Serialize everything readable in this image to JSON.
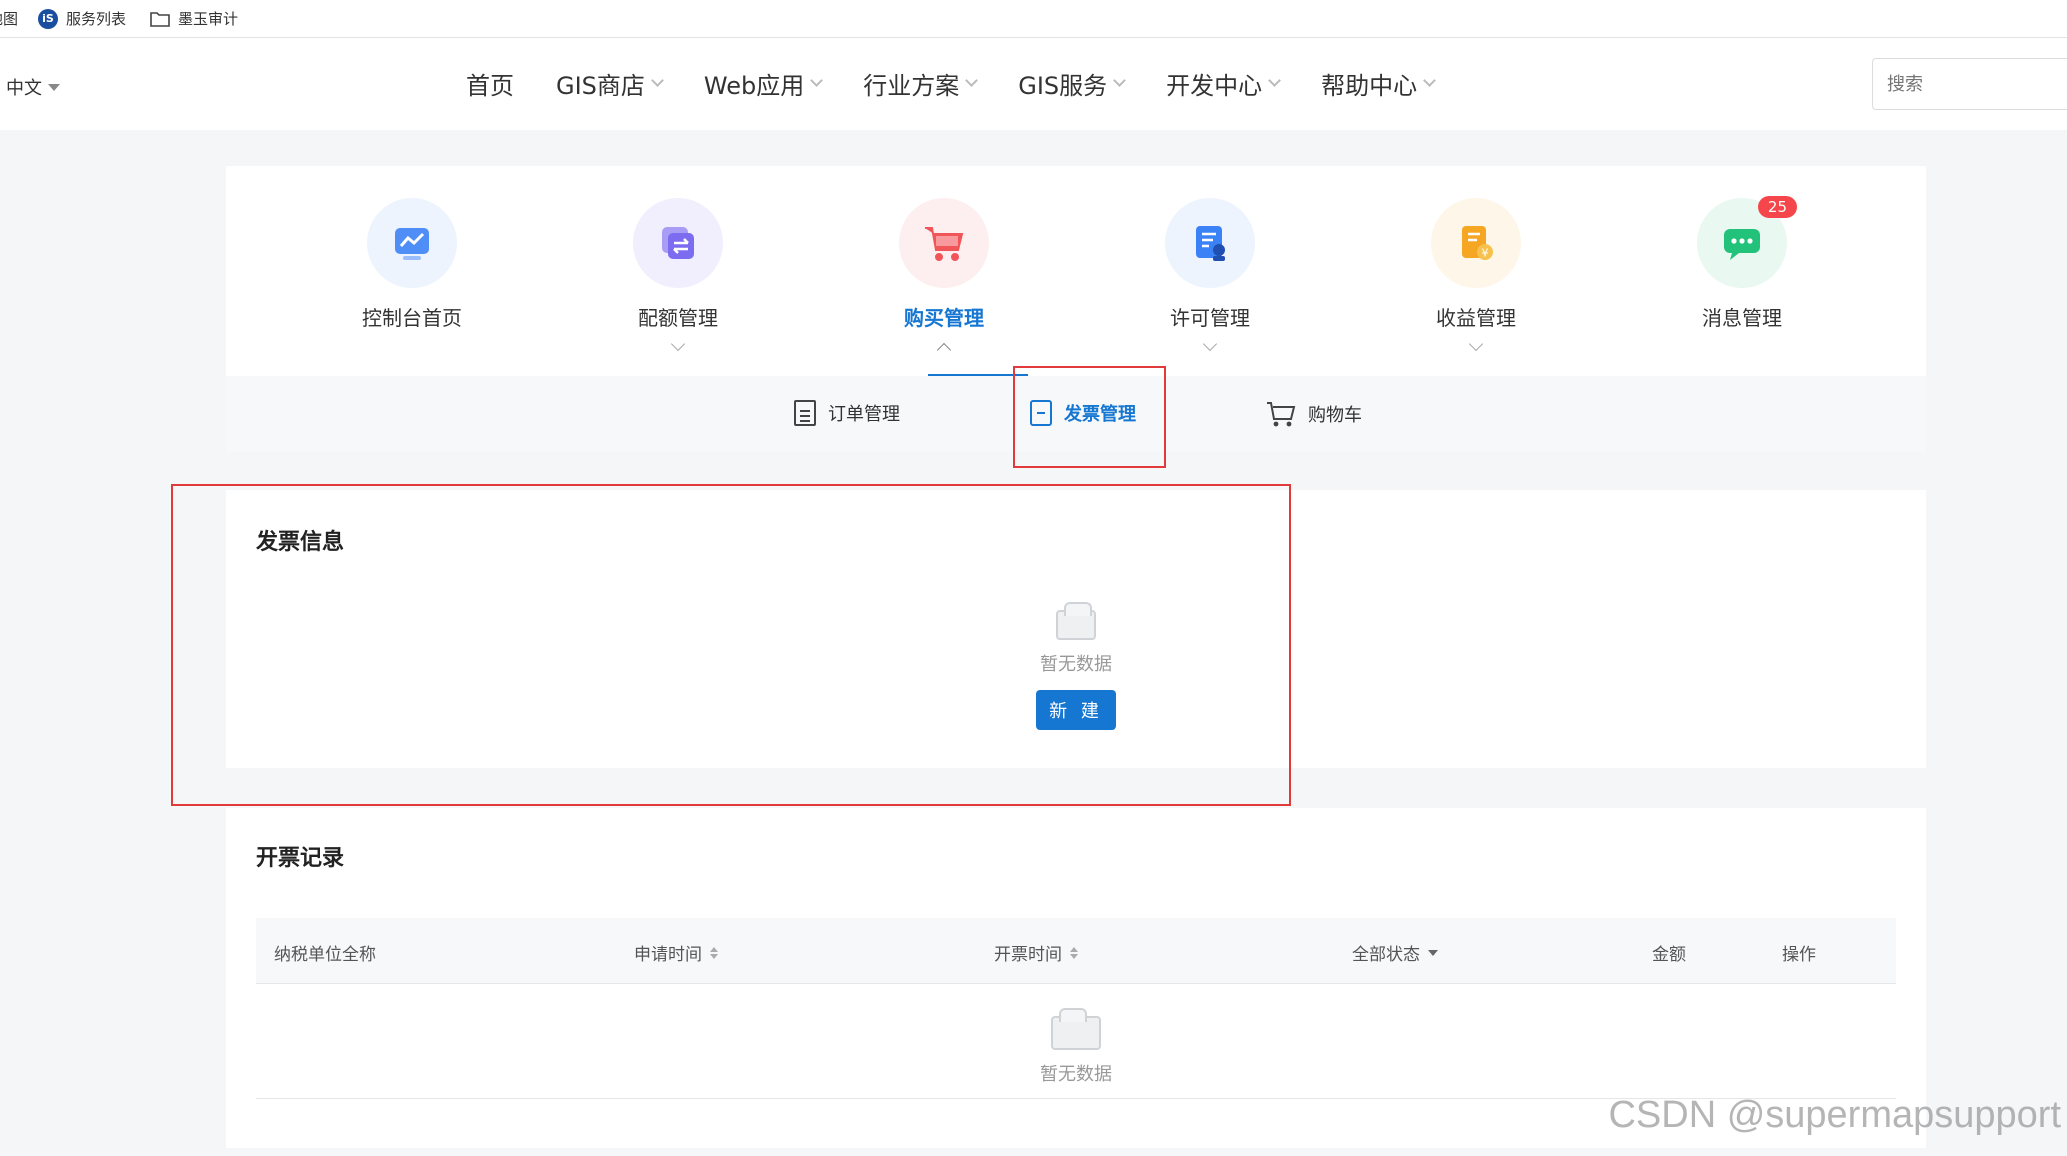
{
  "bookmarks": {
    "items": [
      {
        "label": "地图",
        "icon": "map-icon"
      },
      {
        "label": "服务列表",
        "icon": "iserver-logo-icon"
      },
      {
        "label": "墨玉审计",
        "icon": "folder-icon"
      }
    ],
    "logo_text": "iS"
  },
  "nav": {
    "language": "中文",
    "menu": [
      {
        "label": "首页",
        "has_dropdown": false
      },
      {
        "label": "GIS商店",
        "has_dropdown": true
      },
      {
        "label": "Web应用",
        "has_dropdown": true
      },
      {
        "label": "行业方案",
        "has_dropdown": true
      },
      {
        "label": "GIS服务",
        "has_dropdown": true
      },
      {
        "label": "开发中心",
        "has_dropdown": true
      },
      {
        "label": "帮助中心",
        "has_dropdown": true
      }
    ],
    "search_placeholder": "搜索"
  },
  "console": {
    "items": [
      {
        "label": "控制台首页",
        "icon": "dashboard-icon",
        "color": "#4f8ef7",
        "bg": "#eef4fd"
      },
      {
        "label": "配额管理",
        "icon": "quota-icon",
        "color": "#7b6cf0",
        "bg": "#f1effd"
      },
      {
        "label": "购买管理",
        "icon": "shopping-cart-icon",
        "color": "#f0555a",
        "bg": "#fdeff0",
        "active": true
      },
      {
        "label": "许可管理",
        "icon": "license-icon",
        "color": "#3b82f6",
        "bg": "#edf4fe"
      },
      {
        "label": "收益管理",
        "icon": "revenue-icon",
        "color": "#f5a623",
        "bg": "#fef6e8"
      },
      {
        "label": "消息管理",
        "icon": "message-icon",
        "color": "#23c27a",
        "bg": "#e9f8f1",
        "badge": "25"
      }
    ]
  },
  "subnav": {
    "items": [
      {
        "label": "订单管理",
        "icon": "order-doc-icon"
      },
      {
        "label": "发票管理",
        "icon": "invoice-icon",
        "active": true
      },
      {
        "label": "购物车",
        "icon": "cart-icon"
      }
    ]
  },
  "invoice_info": {
    "title": "发票信息",
    "empty_text": "暂无数据",
    "new_button": "新 建"
  },
  "records": {
    "title": "开票记录",
    "columns": [
      {
        "label": "纳税单位全称",
        "sortable": false,
        "filter": false
      },
      {
        "label": "申请时间",
        "sortable": true,
        "filter": false
      },
      {
        "label": "开票时间",
        "sortable": true,
        "filter": false
      },
      {
        "label": "全部状态",
        "sortable": false,
        "filter": true
      },
      {
        "label": "金额",
        "sortable": false,
        "filter": false
      },
      {
        "label": "操作",
        "sortable": false,
        "filter": false
      }
    ],
    "empty_text": "暂无数据"
  },
  "watermark": "CSDN @supermapsupport",
  "colors": {
    "accent": "#1677d2",
    "highlight_box": "#e23a3a",
    "badge": "#f5474b"
  }
}
